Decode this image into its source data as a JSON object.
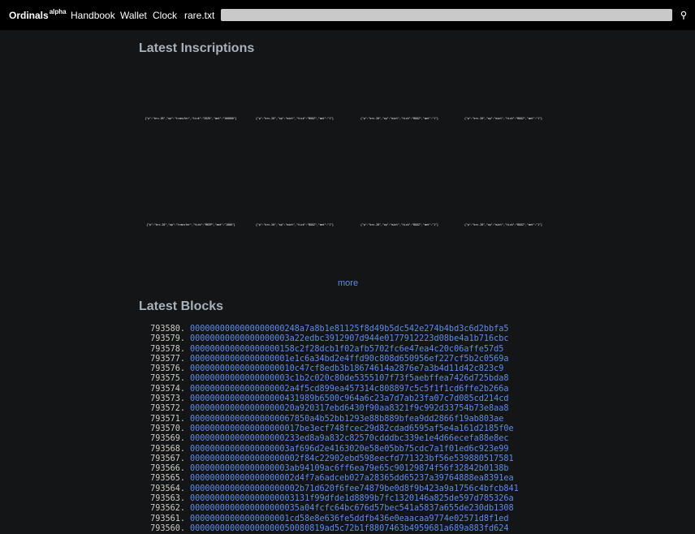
{
  "nav": {
    "brand": "Ordinals",
    "brand_sup": "alpha",
    "links": [
      "Handbook",
      "Wallet",
      "Clock",
      "rare.txt"
    ],
    "search_placeholder": "",
    "search_icon": "magnifier-icon"
  },
  "inscriptions_section": {
    "title": "Latest Inscriptions",
    "items": [
      "{\"p\":\"brc-20\",\"op\":\"transfer\",\"tick\":\"ZOZO\",\"amt\":\"100000\"}",
      "{\"p\":\"brc-20\",\"op\":\"mint\",\"tick\":\"BOOZ\",\"amt\":\"1\"}",
      "{\"p\":\"brc-20\",\"op\":\"mint\",\"tick\":\"BOOZ\",\"amt\":\"1\"}",
      "{\"p\":\"brc-20\",\"op\":\"mint\",\"tick\":\"BOOZ\",\"amt\":\"1\"}",
      "{\"p\":\"brc-20\",\"op\":\"transfer\",\"tick\":\"MEEP\",\"amt\":\"1000\"}",
      "{\"p\":\"brc-20\",\"op\":\"mint\",\"tick\":\"BOOZ\",\"amt\":\"1\"}",
      "{\"p\":\"brc-20\",\"op\":\"mint\",\"tick\":\"BOOZ\",\"amt\":\"1\"}",
      "{\"p\":\"brc-20\",\"op\":\"mint\",\"tick\":\"BOOZ\",\"amt\":\"1\"}"
    ],
    "more_label": "more"
  },
  "blocks_section": {
    "title": "Latest Blocks",
    "blocks": [
      {
        "height": "793580.",
        "hash": "0000000000000000000248a7a8b1e81125f8d49b5dc542e274b4bd3c6d2bbfa5"
      },
      {
        "height": "793579.",
        "hash": "00000000000000000003a22edbc3912907d944e0177912223d08be4a1b716cbc"
      },
      {
        "height": "793578.",
        "hash": "000000000000000000158c2f28dcb1f02afb5702fc6e47ea4c20c06affe57d5"
      },
      {
        "height": "793577.",
        "hash": "00000000000000000001e1c6a34bd2e4ffd90c808d650956ef227cf5b2c0569a"
      },
      {
        "height": "793576.",
        "hash": "000000000000000000010c47cf8edb3b18674614a2876e7a3b4d11d42c823c9"
      },
      {
        "height": "793575.",
        "hash": "00000000000000000003c1b2c020c80de5355107f73f5aebffea7426d725bda8"
      },
      {
        "height": "793574.",
        "hash": "00000000000000000002a4f5cd899ea457314c808897c5c5f1f1cd6ffe2b266a"
      },
      {
        "height": "793573.",
        "hash": "0000000000000000000431989b6500c964a6c23a7d7ab23fa07c7d085cd214cd"
      },
      {
        "height": "793572.",
        "hash": "000000000000000000020a920317ebd6430f90aa8321f9c992d33754b73e8aa8"
      },
      {
        "height": "793571.",
        "hash": "000000000000000000067850a4b52bb1293e88b889bfea9dd2866f19ab803ae"
      },
      {
        "height": "793570.",
        "hash": "0000000000000000000017be3ecf748fcec29d82cdad6595af5e4a161d2185f0e"
      },
      {
        "height": "793569.",
        "hash": "0000000000000000000233ed8a9a832c82570cdddbc339e1e4d66ecefa88e8ec"
      },
      {
        "height": "793568.",
        "hash": "00000000000000000003af696d2e4163020e58e05bb75cdc7a1f01ed6c923e99"
      },
      {
        "height": "793567.",
        "hash": "0000000000000000000002f84c22902ebd598eecfd771323bf56e539880517581"
      },
      {
        "height": "793566.",
        "hash": "00000000000000000003ab94109ac6ff6ea79e65c90129874f56f32842b0138b"
      },
      {
        "height": "793565.",
        "hash": "000000000000000000002d4f7a6adceb027a28365dd65237a39764888ea8391ea"
      },
      {
        "height": "793564.",
        "hash": "0000000000000000000002b71d620f6fee74879be0d8f9b423a9a1756c4bfcb841"
      },
      {
        "height": "793563.",
        "hash": "000000000000000000003131f99dfde1d8899b7fc1320146a825de597d785326a"
      },
      {
        "height": "793562.",
        "hash": "0000000000000000000035a04fcfc64bc676d57bec541a5837a655de230db1308"
      },
      {
        "height": "793561.",
        "hash": "00000000000000000001cd58e8e636fe5ddfb436e0eaacaa9774e02571d8f1ed"
      },
      {
        "height": "793560.",
        "hash": "000000000000000000050080819ad5c72b1f8807463b4959681a689a883fd624"
      }
    ]
  },
  "colors": {
    "background": "#131516",
    "topbar": "#000000",
    "link": "#5f8be8",
    "heading": "#a8b1ba"
  }
}
